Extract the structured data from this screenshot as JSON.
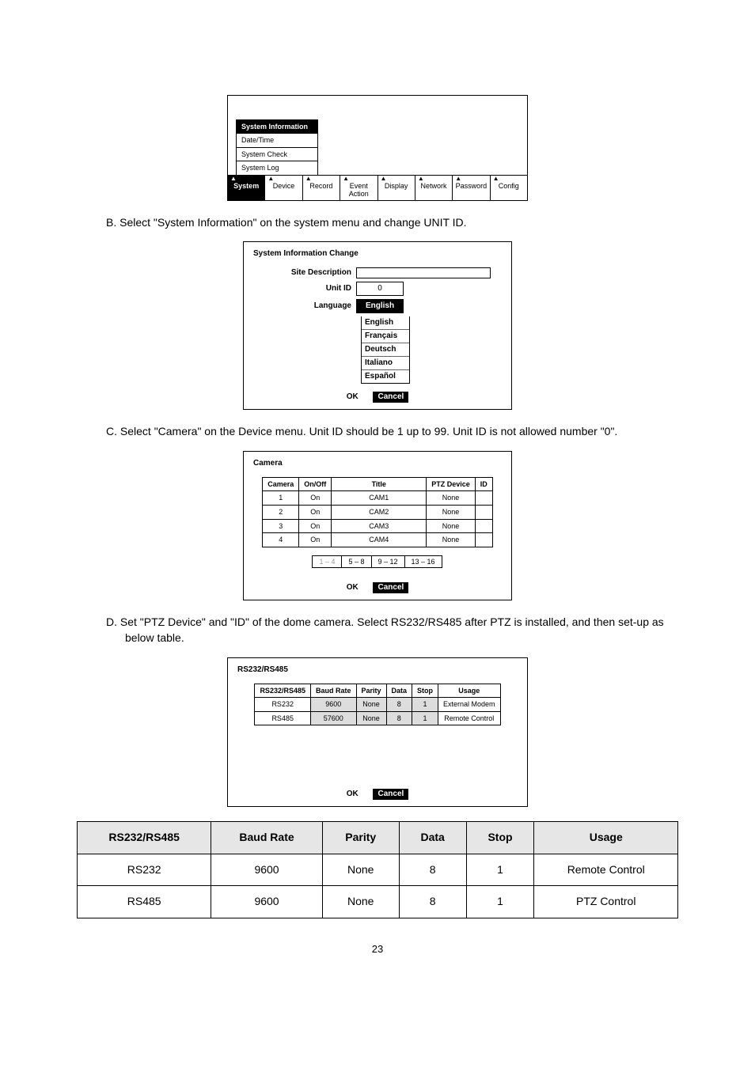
{
  "tabs": [
    "System",
    "Device",
    "Record",
    "Event Action",
    "Display",
    "Network",
    "Password",
    "Config"
  ],
  "menu_stack": {
    "items": [
      "System Information",
      "Date/Time",
      "System Check",
      "System Log"
    ],
    "selected": 0
  },
  "step_b": "B.   Select \"System Information\" on the system menu and change UNIT ID.",
  "sys_info_dialog": {
    "title": "System Information Change",
    "site_label": "Site Description",
    "unit_label": "Unit ID",
    "unit_value": "0",
    "lang_label": "Language",
    "lang_selected": "English",
    "lang_options": [
      "English",
      "Français",
      "Deutsch",
      "Italiano",
      "Español"
    ],
    "ok": "OK",
    "cancel": "Cancel"
  },
  "step_c": "C.   Select \"Camera\" on the Device menu. Unit ID should be 1 up to 99. Unit ID is not allowed number \"0\".",
  "camera_dialog": {
    "title": "Camera",
    "headers": [
      "Camera",
      "On/Off",
      "Title",
      "PTZ Device",
      "ID"
    ],
    "rows": [
      [
        "1",
        "On",
        "CAM1",
        "None",
        ""
      ],
      [
        "2",
        "On",
        "CAM2",
        "None",
        ""
      ],
      [
        "3",
        "On",
        "CAM3",
        "None",
        ""
      ],
      [
        "4",
        "On",
        "CAM4",
        "None",
        ""
      ]
    ],
    "pager": [
      "1 – 4",
      "5 – 8",
      "9 – 12",
      "13 – 16"
    ],
    "ok": "OK",
    "cancel": "Cancel"
  },
  "step_d": "D.   Set \"PTZ Device\" and \"ID\" of the dome camera. Select RS232/RS485 after PTZ is installed, and then set-up as below table.",
  "rs_dialog": {
    "title": "RS232/RS485",
    "headers": [
      "RS232/RS485",
      "Baud Rate",
      "Parity",
      "Data",
      "Stop",
      "Usage"
    ],
    "rows": [
      [
        "RS232",
        "9600",
        "None",
        "8",
        "1",
        "External Modem"
      ],
      [
        "RS485",
        "57600",
        "None",
        "8",
        "1",
        "Remote Control"
      ]
    ],
    "ok": "OK",
    "cancel": "Cancel"
  },
  "big_table": {
    "headers": [
      "RS232/RS485",
      "Baud Rate",
      "Parity",
      "Data",
      "Stop",
      "Usage"
    ],
    "rows": [
      [
        "RS232",
        "9600",
        "None",
        "8",
        "1",
        "Remote Control"
      ],
      [
        "RS485",
        "9600",
        "None",
        "8",
        "1",
        "PTZ Control"
      ]
    ]
  },
  "page_number": "23"
}
